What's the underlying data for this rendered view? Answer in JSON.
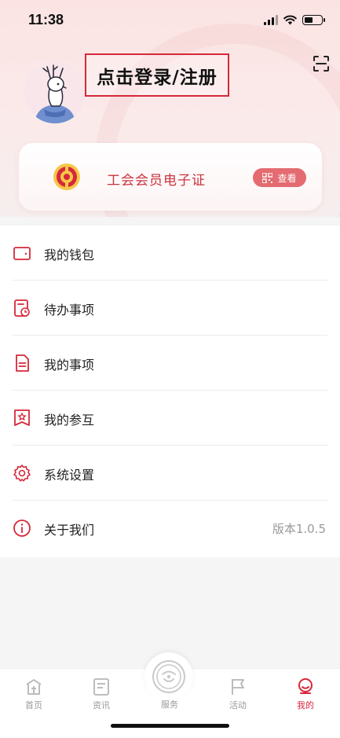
{
  "status_bar": {
    "time": "11:38"
  },
  "profile": {
    "login_label": "点击登录/注册"
  },
  "member_card": {
    "title": "工会会员电子证",
    "button_label": "查看"
  },
  "menu": [
    {
      "label": "我的钱包",
      "icon": "wallet-icon"
    },
    {
      "label": "待办事项",
      "icon": "todo-icon"
    },
    {
      "label": "我的事项",
      "icon": "document-icon"
    },
    {
      "label": "我的参互",
      "icon": "star-doc-icon"
    },
    {
      "label": "系统设置",
      "icon": "gear-icon"
    },
    {
      "label": "关于我们",
      "icon": "info-icon",
      "right_text": "版本1.0.5"
    }
  ],
  "tabbar": {
    "items": [
      {
        "label": "首页",
        "icon": "home-icon"
      },
      {
        "label": "资讯",
        "icon": "news-icon"
      },
      {
        "label": "服务",
        "icon": "service-icon"
      },
      {
        "label": "活动",
        "icon": "flag-icon"
      },
      {
        "label": "我的",
        "icon": "profile-icon",
        "active": true
      }
    ]
  },
  "colors": {
    "accent": "#d6283a",
    "card_button": "#e36b71",
    "inactive": "#999999"
  }
}
